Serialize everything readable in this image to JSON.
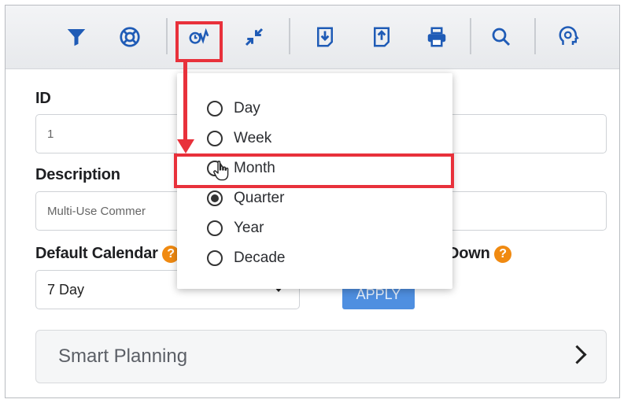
{
  "toolbar": {
    "icons": [
      "filter-icon",
      "lifebuoy-icon",
      "timescale-icon",
      "collapse-icon",
      "export-down-icon",
      "export-up-icon",
      "print-icon",
      "search-icon",
      "brain-icon"
    ]
  },
  "form": {
    "id_label": "ID",
    "id_value": "1",
    "description_label": "Description",
    "description_value": "Multi-Use Commer",
    "default_calendar_label": "Default Calendar",
    "drilldown_label": "Down",
    "calendar_value": "7 Day",
    "apply_label": "APPLY",
    "help_glyph": "?"
  },
  "smart_planning": {
    "label": "Smart Planning"
  },
  "timescale_menu": {
    "options": [
      {
        "label": "Day",
        "checked": false
      },
      {
        "label": "Week",
        "checked": false
      },
      {
        "label": "Month",
        "checked": false
      },
      {
        "label": "Quarter",
        "checked": true
      },
      {
        "label": "Year",
        "checked": false
      },
      {
        "label": "Decade",
        "checked": false
      }
    ]
  },
  "colors": {
    "accent_red": "#e8313b",
    "icon_blue": "#1f5bb6",
    "help_orange": "#f08a11",
    "apply_blue": "#4f8fe0"
  }
}
